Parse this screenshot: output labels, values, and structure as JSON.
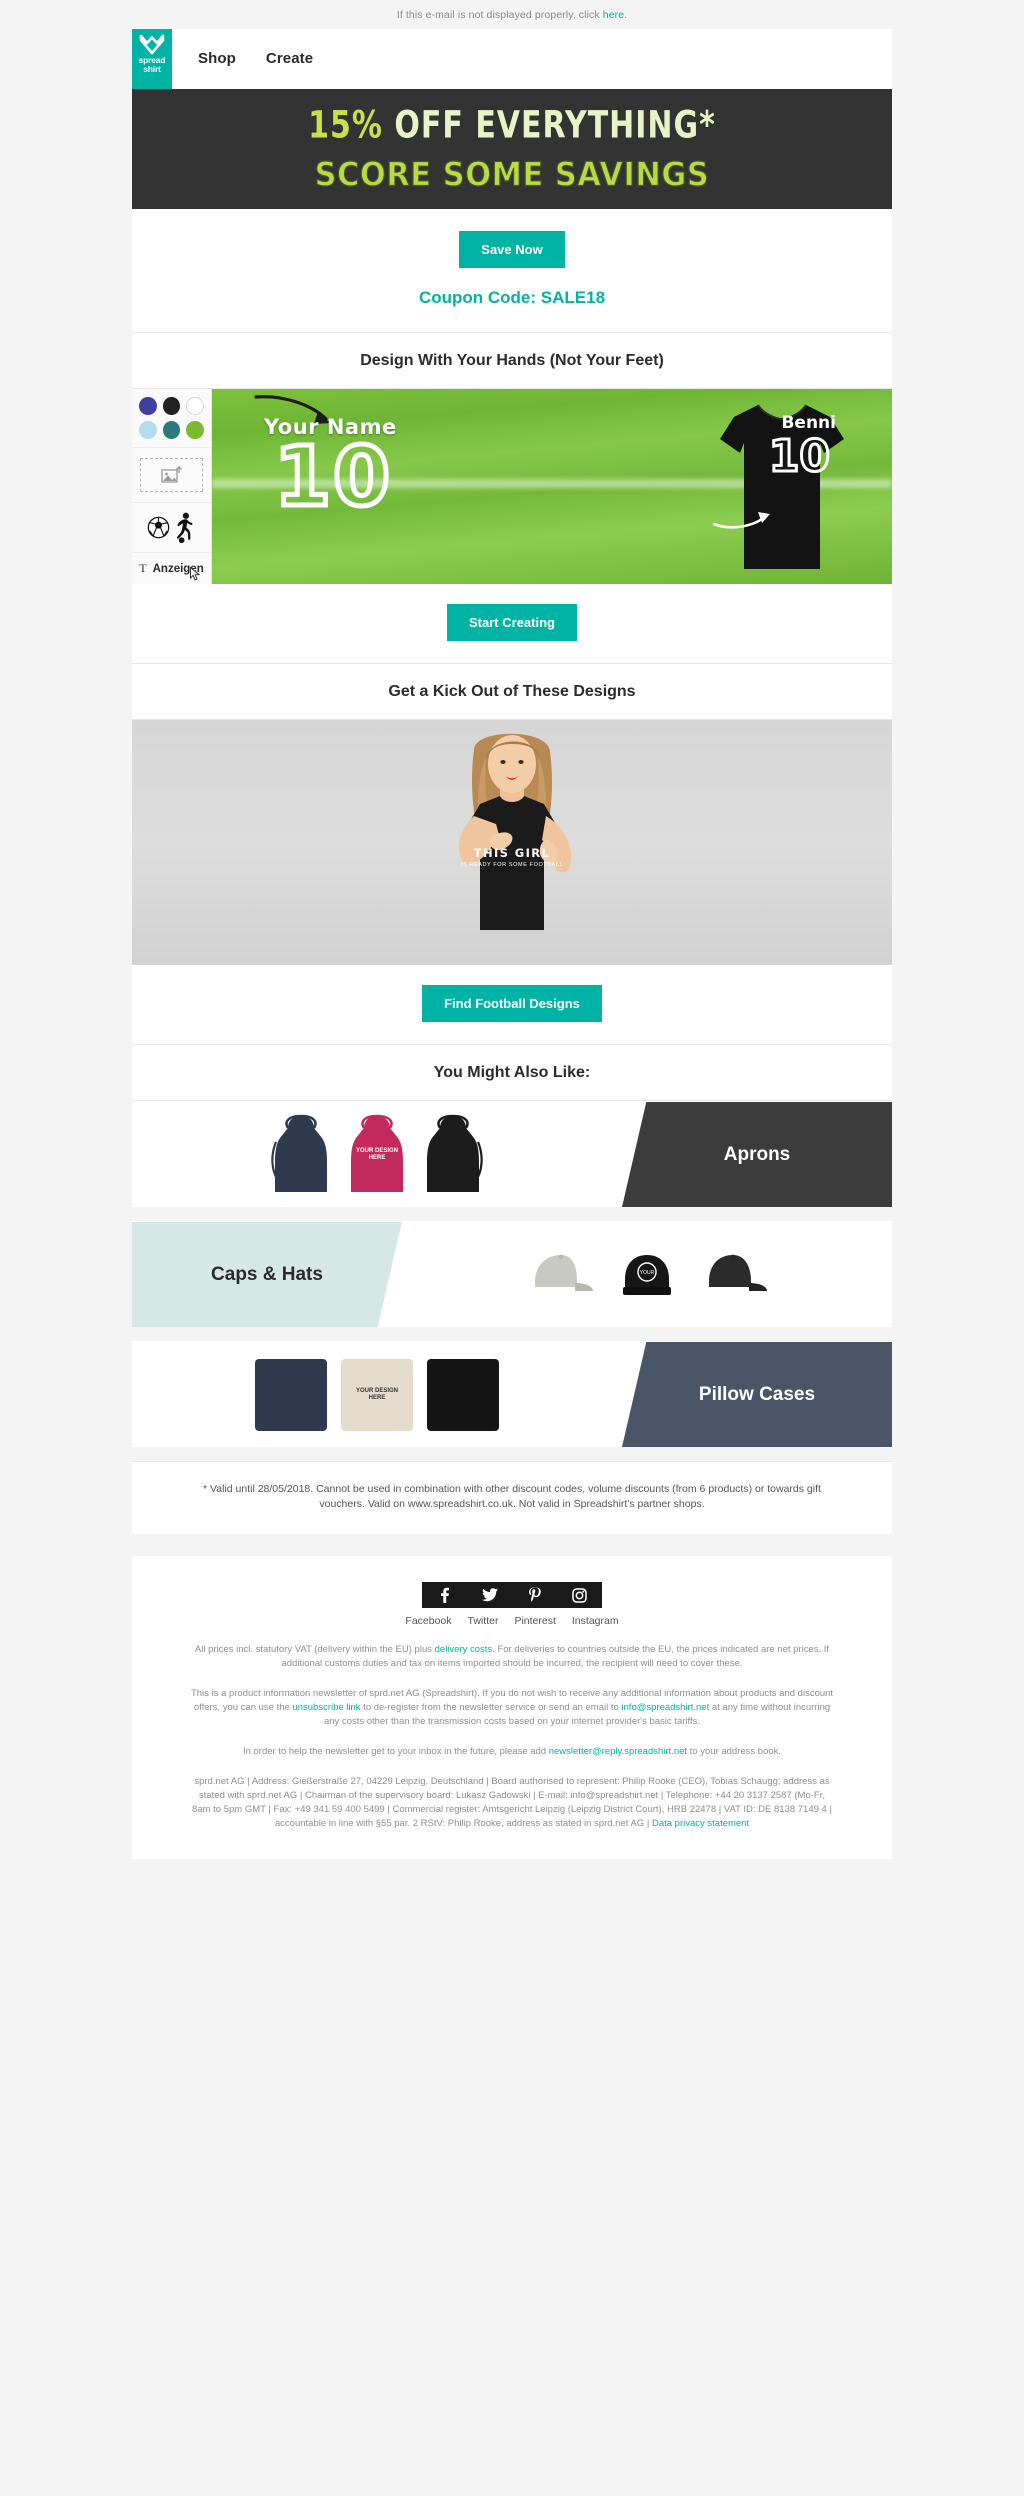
{
  "preheader": {
    "text": "If this e-mail is not displayed properly, click ",
    "link": "here."
  },
  "brand": {
    "accent": "#00b3a4",
    "dark": "#333333",
    "lime": "#c6e04f",
    "cream": "#e8f3c8"
  },
  "header": {
    "logo_line1": "spread",
    "logo_line2": "shirt",
    "nav": [
      {
        "label": "Shop"
      },
      {
        "label": "Create"
      }
    ]
  },
  "hero": {
    "line1_percent": "15%",
    "line1_rest": " OFF EVERYTHING*",
    "line2": "SCORE SOME SAVINGS"
  },
  "cta": {
    "button_label": "Save Now",
    "coupon_text": "Coupon Code: SALE18"
  },
  "editor_section": {
    "title": "Design With Your Hands (Not Your Feet)",
    "swatches": [
      {
        "name": "indigo",
        "color": "#3f3f9e"
      },
      {
        "name": "black",
        "color": "#222222"
      },
      {
        "name": "white",
        "color": "#ffffff"
      },
      {
        "name": "light-blue",
        "color": "#b4dcec"
      },
      {
        "name": "teal",
        "color": "#2d7a7c"
      },
      {
        "name": "green",
        "color": "#7cb92e"
      }
    ],
    "upload_icon": "image-upload-icon",
    "clipart": [
      {
        "name": "soccer-ball-icon"
      },
      {
        "name": "soccer-player-icon"
      }
    ],
    "text_tool_icon": "T",
    "text_tool_label": "Anzeigen",
    "canvas": {
      "placeholder_name": "Your Name",
      "placeholder_number": "10",
      "shirt_name": "Benni",
      "shirt_number": "10"
    },
    "start_button": "Start Creating"
  },
  "designs_section": {
    "title": "Get a Kick Out of These Designs",
    "tee_line1": "THIS GIRL",
    "tee_line2": "IS READY FOR SOME FOOTBALL",
    "button_label": "Find Football Designs"
  },
  "also_like": {
    "title": "You Might Also Like:",
    "bands": [
      {
        "label": "Aprons",
        "style": "dark",
        "badge": "YOUR DESIGN HERE"
      },
      {
        "label": "Caps & Hats",
        "style": "light",
        "badge": ""
      },
      {
        "label": "Pillow Cases",
        "style": "navy",
        "badge": "YOUR DESIGN HERE"
      }
    ]
  },
  "legal": {
    "disclaimer": "* Valid until 28/05/2018. Cannot be used in combination with other discount codes, volume discounts (from 6 products) or towards gift vouchers. Valid on www.spreadshirt.co.uk. Not valid in Spreadshirt's partner shops."
  },
  "footer": {
    "social": [
      {
        "name": "facebook-icon",
        "glyph": "f",
        "label": "Facebook"
      },
      {
        "name": "twitter-icon",
        "glyph": "t",
        "label": "Twitter"
      },
      {
        "name": "pinterest-icon",
        "glyph": "P",
        "label": "Pinterest"
      },
      {
        "name": "instagram-icon",
        "glyph": "o",
        "label": "Instagram"
      }
    ],
    "vat_pre": "All prices incl. statutory VAT (delivery within the EU) plus ",
    "vat_link": "delivery costs",
    "vat_post": ". For deliveries to countries outside the EU, the prices indicated are net prices. If additional customs duties and tax on items imported should be incurred, the recipient will need to cover these.",
    "unsub_1": "This is a product information newsletter of sprd.net AG (Spreadshirt). If you do not wish to receive any additional information about products and discount offers, you can use the ",
    "unsub_link": "unsubscribe link",
    "unsub_2": " to de-register from the newsletter service or send an email to ",
    "unsub_email": "info@spreadshirt.net",
    "unsub_3": " at any time without incurring any costs other than the transmission costs based on your internet provider's basic tariffs.",
    "inbox_1": "In order to help the newsletter get to your inbox in the future, please add ",
    "inbox_email": "newsletter@reply.spreadshirt.net",
    "inbox_2": " to your address book.",
    "imprint": "sprd.net AG | Address: Gießerstraße 27, 04229 Leipzig, Deutschland | Board authorised to represent: Philip Rooke (CEO), Tobias Schaugg; address as stated with sprd.net AG | Chairman of the supervisory board: Lukasz Gadowski | E-mail: info@spreadshirt.net | Telephone: +44 20 3137 2587 (Mo-Fr, 8am to 5pm GMT | Fax: +49 341 59 400 5499 | Commercial register: Amtsgericht Leipzig (Leipzig District Court), HRB 22478 | VAT ID: DE 8138 7149 4 | accountable in line with §55 par. 2 RStV: Philip Rooke, address as stated in sprd.net AG | ",
    "privacy_link": "Data privacy statement"
  }
}
